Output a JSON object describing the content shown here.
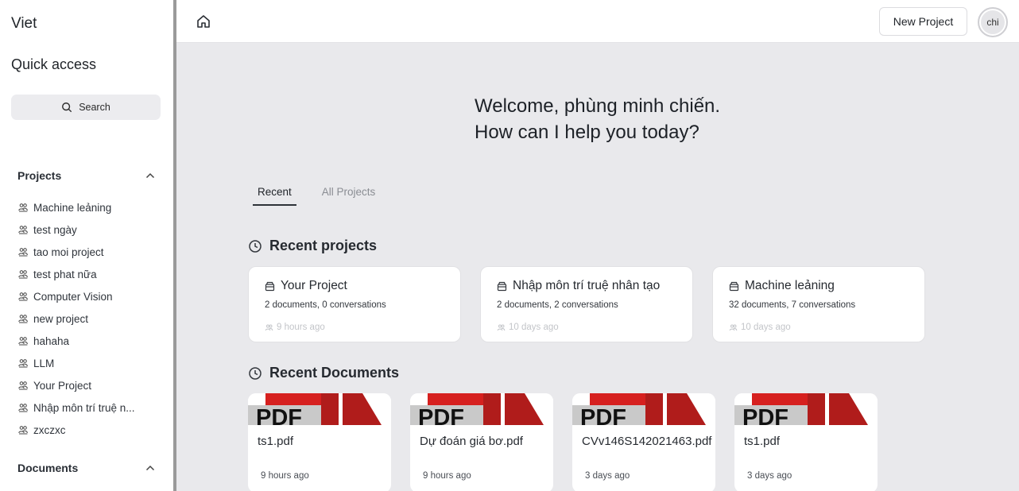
{
  "sidebar": {
    "brand": "Viet",
    "quick_access": "Quick access",
    "search_label": "Search",
    "projects_heading": "Projects",
    "projects": [
      "Machine leảning",
      "test ngày",
      "tao moi project",
      "test phat nữa",
      "Computer Vision",
      "new project",
      "hahaha",
      "LLM",
      "Your Project",
      "Nhập môn trí truệ n...",
      "zxczxc"
    ],
    "documents_heading": "Documents"
  },
  "topbar": {
    "new_project_label": "New Project",
    "avatar_text": "chi"
  },
  "main": {
    "welcome_line1": "Welcome, phùng minh chiến.",
    "welcome_line2": "How can I help you today?",
    "tabs": [
      "Recent",
      "All Projects"
    ],
    "recent_projects_title": "Recent projects",
    "recent_projects": [
      {
        "name": "Your Project",
        "meta": "2 documents, 0 conversations",
        "time": "9 hours ago"
      },
      {
        "name": "Nhập môn trí truệ nhân tạo",
        "meta": "2 documents, 2 conversations",
        "time": "10 days ago"
      },
      {
        "name": "Machine leảning",
        "meta": "32 documents, 7 conversations",
        "time": "10 days ago"
      }
    ],
    "recent_documents_title": "Recent Documents",
    "pdf_label": "PDF",
    "recent_documents": [
      {
        "name": "ts1.pdf",
        "time": "9 hours ago"
      },
      {
        "name": "Dự đoán giá bơ.pdf",
        "time": "9 hours ago"
      },
      {
        "name": "CVv146S142021463.pdf",
        "time": "3 days ago"
      },
      {
        "name": "ts1.pdf",
        "time": "3 days ago"
      }
    ]
  },
  "colors": {
    "pdf_red": "#d6201f",
    "pdf_dark_red": "#b01c1b",
    "pdf_grey": "#c9c9c9",
    "main_bg": "#e9e9ec"
  }
}
